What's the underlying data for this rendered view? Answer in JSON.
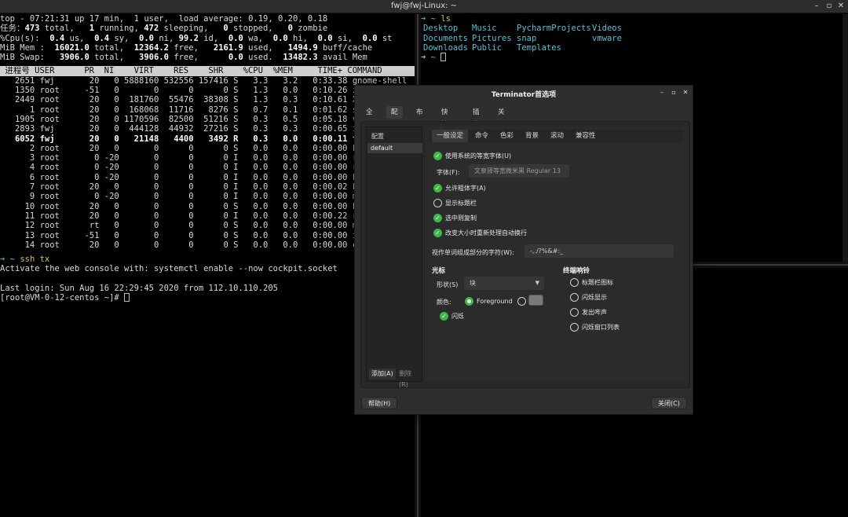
{
  "window": {
    "title": "fwj@fwj-Linux: ~",
    "buttons": {
      "minimize": "–",
      "maximize": "▫",
      "close": "✕"
    }
  },
  "left_terminal": {
    "summary": [
      "top - 07:21:31 up 17 min,  1 user,  load average: 0.19, 0.20, 0.18",
      "任务：<b>473</b> total,   <b>1</b> running, <b>472</b> sleeping,   <b>0</b> stopped,   <b>0</b> zombie",
      "%Cpu(s):  <b>0.4</b> us,  <b>0.4</b> sy,  <b>0.0</b> ni, <b>99.2</b> id,  <b>0.0</b> wa,  <b>0.0</b> hi,  <b>0.0</b> si,  <b>0.0</b> st",
      "MiB Mem :  <b>16021.0</b> total,  <b>12364.2</b> free,   <b>2161.9</b> used,   <b>1494.9</b> buff/cache",
      "MiB Swap:   <b>3906.0</b> total,   <b>3906.0</b> free,      <b>0.0</b> used.  <b>13482.3</b> avail Mem"
    ],
    "table_header": " 进程号 USER      PR  NI    VIRT    RES    SHR    %CPU  %MEM     TIME+ COMMAND                                  ",
    "processes": [
      {
        "line": "   2651 fwj       20   0 5888160 532556 157416 S   3.3   3.2   0:33.38 gnome-shell",
        "bold": false
      },
      {
        "line": "   1350 root     -51   0       0      0      0 S   1.3   0.0   0:10.26 irq/133-n",
        "bold": false
      },
      {
        "line": "   2449 root      20   0  181760  55476  38308 S   1.3   0.3   0:10.61 Xorg",
        "bold": false
      },
      {
        "line": "      1 root      20   0  168068  11716   8276 S   0.7   0.1   0:01.62 systemd",
        "bold": false
      },
      {
        "line": "   1905 root      20   0 1170596  82500  51216 S   0.3   0.5   0:05.18 vmware-ho",
        "bold": false
      },
      {
        "line": "   2893 fwj       20   0  444128  44932  27216 S   0.3   0.3   0:00.65 indicator",
        "bold": false
      },
      {
        "line": "   6052 fwj       20   0   21148   4400   3492 R   0.3   0.0   0:00.11 top",
        "bold": true
      },
      {
        "line": "      2 root      20   0       0      0      0 S   0.0   0.0   0:00.00 kthreadd",
        "bold": false
      },
      {
        "line": "      3 root       0 -20       0      0      0 I   0.0   0.0   0:00.00 rcu_gp",
        "bold": false
      },
      {
        "line": "      4 root       0 -20       0      0      0 I   0.0   0.0   0:00.00 rcu_par_g",
        "bold": false
      },
      {
        "line": "      6 root       0 -20       0      0      0 I   0.0   0.0   0:00.00 kworker/0",
        "bold": false
      },
      {
        "line": "      7 root      20   0       0      0      0 I   0.0   0.0   0:00.02 kworker/0",
        "bold": false
      },
      {
        "line": "      9 root       0 -20       0      0      0 I   0.0   0.0   0:00.00 mm_percpu",
        "bold": false
      },
      {
        "line": "     10 root      20   0       0      0      0 S   0.0   0.0   0:00.00 ksoftirqd",
        "bold": false
      },
      {
        "line": "     11 root      20   0       0      0      0 I   0.0   0.0   0:00.22 rcu_sched",
        "bold": false
      },
      {
        "line": "     12 root      rt   0       0      0      0 S   0.0   0.0   0:00.00 migration",
        "bold": false
      },
      {
        "line": "     13 root     -51   0       0      0      0 S   0.0   0.0   0:00.00 idle_inje",
        "bold": false
      },
      {
        "line": "     14 root      20   0       0      0      0 S   0.0   0.0   0:00.00 cpuhp/0",
        "bold": false
      }
    ],
    "prompt_arrow": "➜",
    "prompt_dir": "~",
    "command": "ssh tx",
    "output_lines": [
      "Activate the web console with: systemctl enable --now cockpit.socket",
      "",
      "Last login: Sun Aug 16 22:29:45 2020 from 112.10.110.205"
    ],
    "remote_prompt": "[root@VM-0-12-centos ~]# "
  },
  "right_terminal": {
    "prompt_arrow": "➜",
    "prompt_dir": "~",
    "command": "ls",
    "ls_rows": [
      [
        "Desktop",
        "Music",
        "PycharmProjects",
        "Videos"
      ],
      [
        "Documents",
        "Pictures",
        "snap",
        "vmware"
      ],
      [
        "Downloads",
        "Public",
        "Templates",
        ""
      ]
    ]
  },
  "dialog": {
    "title": "Terminator首选项",
    "top_tabs": [
      "全局",
      "配置",
      "布局",
      "快捷键",
      "插件",
      "关于"
    ],
    "active_top_tab": "配置",
    "profiles_header": "配置",
    "profiles": [
      "default"
    ],
    "add_button": "添加(A)",
    "remove_button": "删除(R)",
    "sub_tabs": [
      "一般设定",
      "命令",
      "色彩",
      "背景",
      "滚动",
      "兼容性"
    ],
    "active_sub_tab": "一般设定",
    "use_system_font": {
      "label": "使用系统的等宽字体(U)",
      "checked": true
    },
    "font_label": "字体(F):",
    "font_value": "文泉驿等宽微米黑 Regular  13",
    "allow_bold": {
      "label": "允许粗体字(A)",
      "checked": true
    },
    "show_titlebar": {
      "label": "显示标题栏",
      "checked": false
    },
    "copy_on_select": {
      "label": "选中则复制",
      "checked": true
    },
    "rewrap_on_resize": {
      "label": "改变大小时重新处理自动换行",
      "checked": true
    },
    "word_chars_label": "视作单词组成部分的字符(W):",
    "word_chars_value": "-,./?%&#:_",
    "cursor_section": "光标",
    "shape_label": "形状(S)",
    "shape_value": "块",
    "color_label": "颜色:",
    "color_fg": "Foreground",
    "blink": {
      "label": "闪烁",
      "checked": true
    },
    "bell_section": "终端响铃",
    "bell_options": [
      "标题栏图标",
      "闪烁显示",
      "发出哔声",
      "闪烁窗口列表"
    ],
    "help_button": "帮助(H)",
    "close_button": "关闭(C)",
    "colors": {
      "check_green": "#3fb649",
      "swatch": "#7a7a7a"
    }
  }
}
